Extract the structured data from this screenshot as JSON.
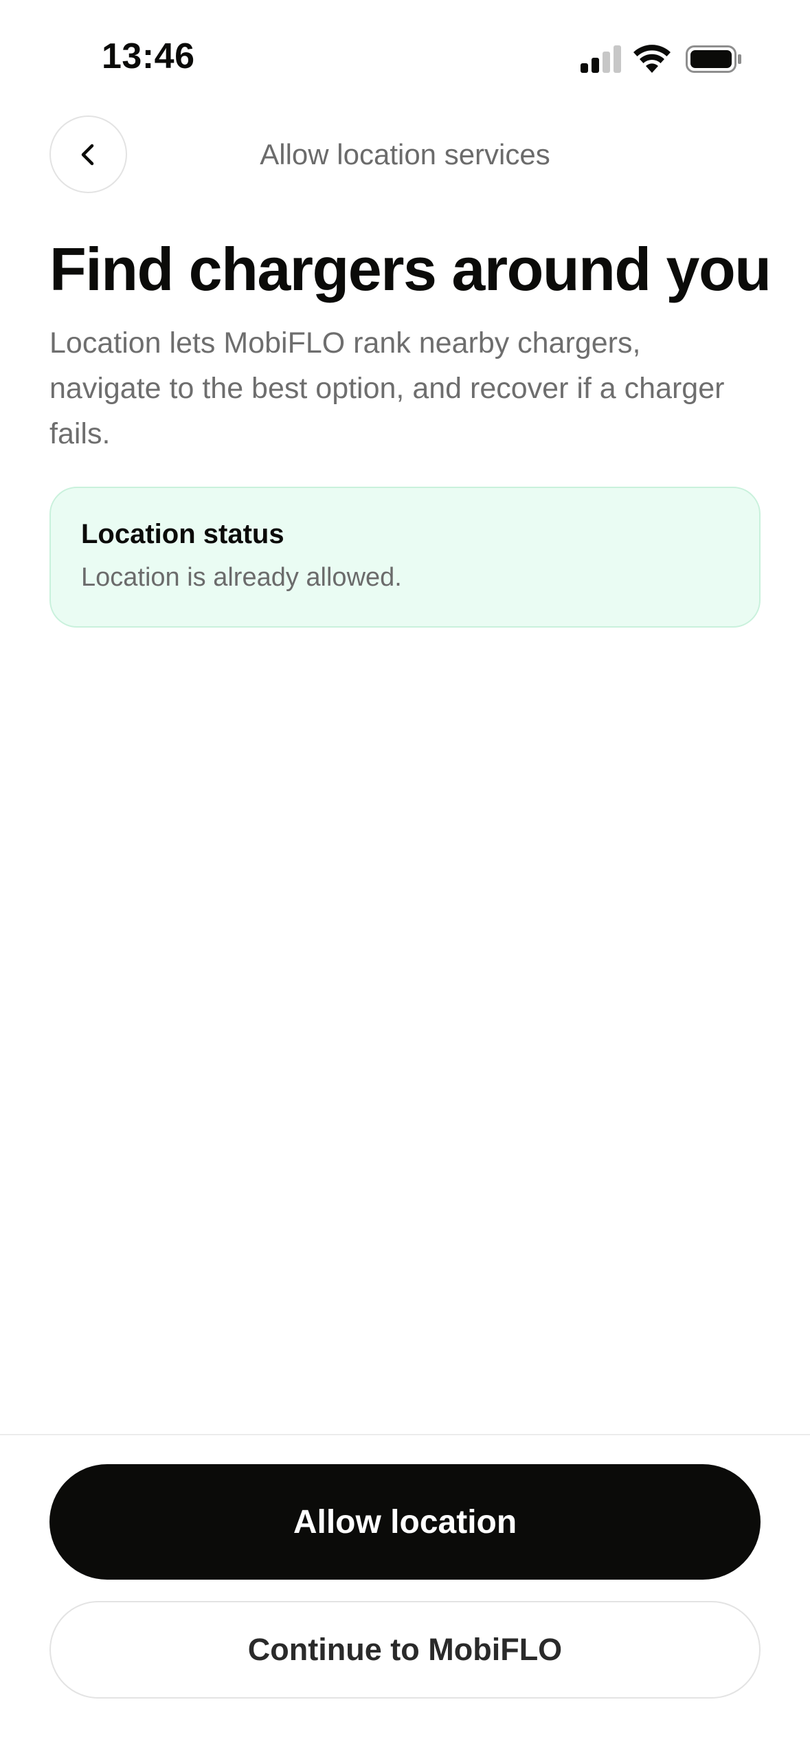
{
  "status_bar": {
    "time": "13:46",
    "icons": [
      "cellular-signal-icon",
      "wifi-icon",
      "battery-icon"
    ]
  },
  "header": {
    "back_icon": "chevron-left-icon",
    "title": "Allow location services"
  },
  "main": {
    "headline": "Find chargers around you",
    "description": "Location lets MobiFLO rank nearby chargers, navigate to the best option, and recover if a charger fails.",
    "status_card": {
      "title": "Location status",
      "message": "Location is already allowed."
    }
  },
  "actions": {
    "primary_label": "Allow location",
    "secondary_label": "Continue to MobiFLO"
  },
  "colors": {
    "primary_button": "#0b0b09",
    "status_card_bg": "#eafcf3",
    "status_card_border": "#c9f1dc",
    "muted_text": "#6e6e6e"
  }
}
